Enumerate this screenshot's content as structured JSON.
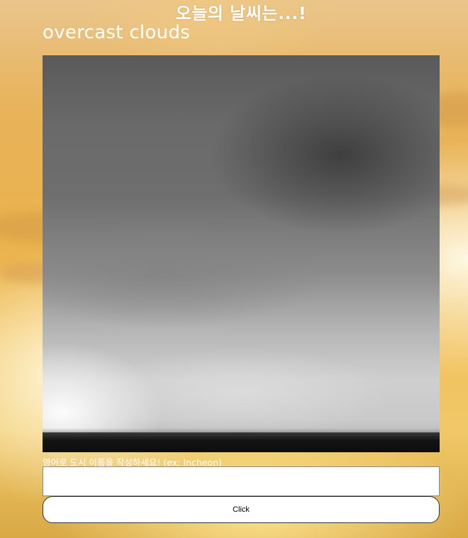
{
  "header": {
    "title": "오늘의 날씨는...!",
    "condition": "overcast clouds"
  },
  "weather_image": {
    "icon": "overcast-sky-photo"
  },
  "form": {
    "prompt_label": "영어로 도시 이름을 작성하세요! (ex: Incheon)",
    "city_input_value": "",
    "city_input_placeholder": "",
    "submit_label": "Click"
  },
  "colors": {
    "background_accent": "#eab24c",
    "text": "#ffffff",
    "button_bg": "#ffffff",
    "button_border": "#333333"
  }
}
